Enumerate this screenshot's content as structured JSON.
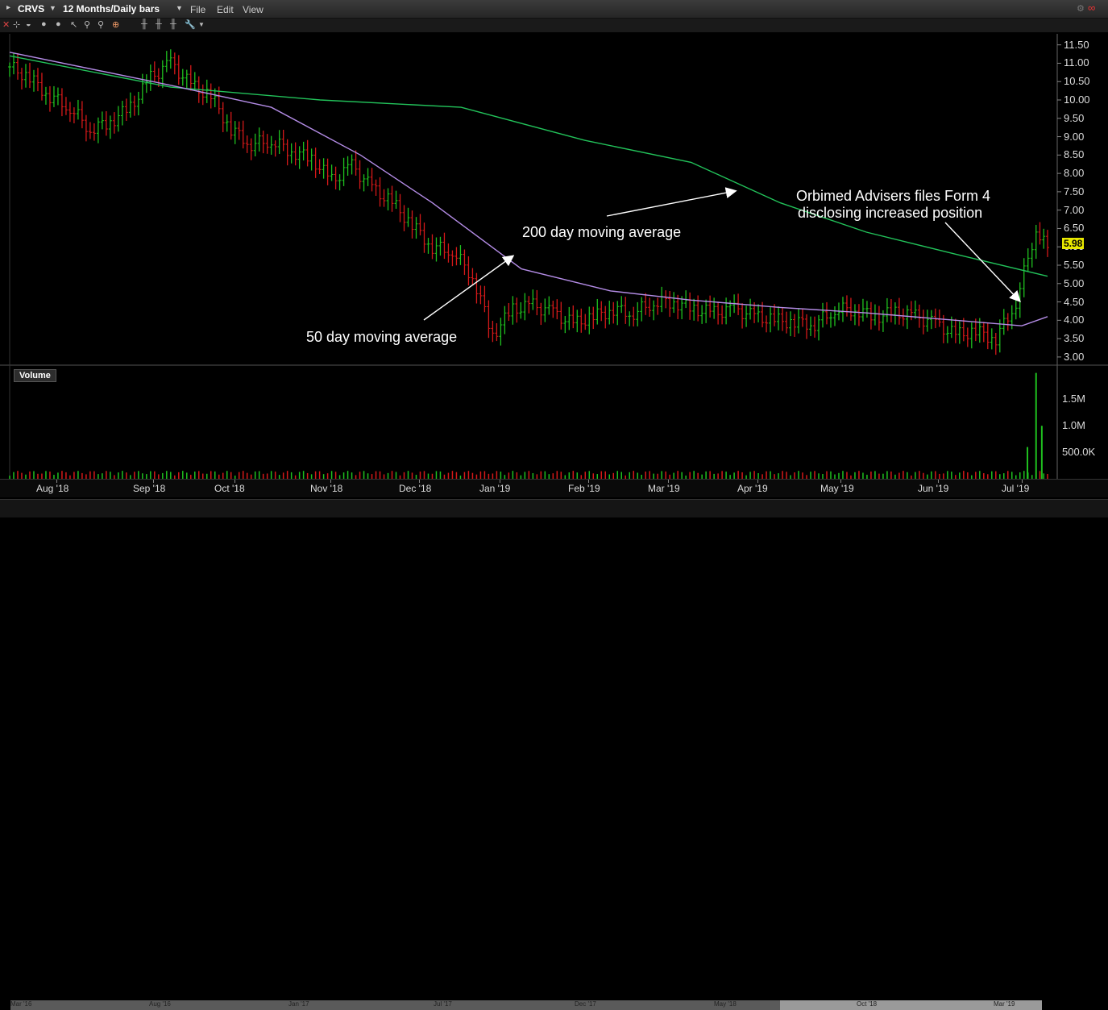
{
  "window": {
    "symbol": "CRVS",
    "period": "12 Months/Daily bars",
    "menu": [
      "File",
      "Edit",
      "View"
    ]
  },
  "toolbar": {
    "icons": [
      "close-icon",
      "crosshair-icon",
      "circle-icon",
      "circle-icon",
      "pointer-icon",
      "zoom-in-icon",
      "zoom-out-icon",
      "target-icon",
      "bar-style-icon",
      "bar-style-icon",
      "bar-style-icon",
      "wrench-icon",
      "dropdown-icon"
    ]
  },
  "price_axis_labels": [
    "11.50",
    "11.00",
    "10.50",
    "10.00",
    "9.50",
    "9.00",
    "8.50",
    "8.00",
    "7.50",
    "7.00",
    "6.50",
    "6.00",
    "5.50",
    "5.00",
    "4.50",
    "4.00",
    "3.50",
    "3.00"
  ],
  "last_price": "5.98",
  "volume_title": "Volume",
  "volume_axis_labels": [
    "1.5M",
    "1.0M",
    "500.0K"
  ],
  "annotations": {
    "ma200": "200 day moving average",
    "ma50": "50 day moving average",
    "orbimed_line1": "Orbimed Advisers files Form 4",
    "orbimed_line2": "disclosing increased position"
  },
  "date_labels": [
    "Aug '18",
    "Sep '18",
    "Oct '18",
    "Nov '18",
    "Dec '18",
    "Jan '19",
    "Feb '19",
    "Mar '19",
    "Apr '19",
    "May '19",
    "Jun '19",
    "Jul '19"
  ],
  "nav_labels": [
    "Mar '16",
    "Aug '16",
    "Jan '17",
    "Jul '17",
    "Dec '17",
    "May '18",
    "Oct '18",
    "Mar '19"
  ],
  "colors": {
    "up": "#1fc01f",
    "down": "#d41919",
    "ma50": "#b48ce6",
    "ma200": "#22c25a",
    "grid": "#333333"
  },
  "chart_data": {
    "type": "ohlc",
    "title": "CRVS",
    "ylim": [
      2.8,
      11.8
    ],
    "x_start": "2018-07-16",
    "x_end": "2019-07-12",
    "close_series": [
      [
        "2018-07-16",
        10.9
      ],
      [
        "2018-07-23",
        10.6
      ],
      [
        "2018-07-30",
        10.1
      ],
      [
        "2018-08-06",
        9.8
      ],
      [
        "2018-08-13",
        9.2
      ],
      [
        "2018-08-20",
        9.4
      ],
      [
        "2018-08-27",
        9.8
      ],
      [
        "2018-09-03",
        10.6
      ],
      [
        "2018-09-10",
        11.0
      ],
      [
        "2018-09-17",
        10.4
      ],
      [
        "2018-09-24",
        10.1
      ],
      [
        "2018-10-01",
        9.2
      ],
      [
        "2018-10-08",
        8.8
      ],
      [
        "2018-10-15",
        8.9
      ],
      [
        "2018-10-22",
        8.6
      ],
      [
        "2018-10-29",
        8.4
      ],
      [
        "2018-11-05",
        7.8
      ],
      [
        "2018-11-12",
        8.2
      ],
      [
        "2018-11-19",
        7.6
      ],
      [
        "2018-11-26",
        7.2
      ],
      [
        "2018-12-03",
        6.6
      ],
      [
        "2018-12-10",
        6.0
      ],
      [
        "2018-12-17",
        5.9
      ],
      [
        "2018-12-24",
        5.2
      ],
      [
        "2018-12-31",
        3.6
      ],
      [
        "2019-01-07",
        4.3
      ],
      [
        "2019-01-14",
        4.4
      ],
      [
        "2019-01-21",
        4.2
      ],
      [
        "2019-01-28",
        3.9
      ],
      [
        "2019-02-04",
        4.1
      ],
      [
        "2019-02-11",
        4.3
      ],
      [
        "2019-02-18",
        4.2
      ],
      [
        "2019-02-25",
        4.5
      ],
      [
        "2019-03-04",
        4.5
      ],
      [
        "2019-03-11",
        4.3
      ],
      [
        "2019-03-18",
        4.2
      ],
      [
        "2019-03-25",
        4.3
      ],
      [
        "2019-04-01",
        4.1
      ],
      [
        "2019-04-08",
        4.0
      ],
      [
        "2019-04-15",
        3.95
      ],
      [
        "2019-04-22",
        3.9
      ],
      [
        "2019-04-29",
        4.3
      ],
      [
        "2019-05-06",
        4.3
      ],
      [
        "2019-05-13",
        4.1
      ],
      [
        "2019-05-20",
        4.2
      ],
      [
        "2019-05-27",
        4.1
      ],
      [
        "2019-06-03",
        3.9
      ],
      [
        "2019-06-10",
        3.6
      ],
      [
        "2019-06-17",
        3.7
      ],
      [
        "2019-06-24",
        3.5
      ],
      [
        "2019-07-01",
        4.5
      ],
      [
        "2019-07-08",
        6.5
      ],
      [
        "2019-07-12",
        5.98
      ]
    ],
    "ma50": [
      [
        "2018-07-16",
        11.3
      ],
      [
        "2018-09-10",
        10.4
      ],
      [
        "2018-10-15",
        9.8
      ],
      [
        "2018-11-15",
        8.5
      ],
      [
        "2018-12-10",
        7.2
      ],
      [
        "2019-01-10",
        5.4
      ],
      [
        "2019-02-10",
        4.8
      ],
      [
        "2019-03-10",
        4.55
      ],
      [
        "2019-04-10",
        4.35
      ],
      [
        "2019-05-10",
        4.2
      ],
      [
        "2019-06-10",
        4.0
      ],
      [
        "2019-07-03",
        3.85
      ],
      [
        "2019-07-12",
        4.1
      ]
    ],
    "ma200": [
      [
        "2018-07-16",
        11.2
      ],
      [
        "2018-09-10",
        10.35
      ],
      [
        "2018-11-01",
        10.0
      ],
      [
        "2018-12-20",
        9.8
      ],
      [
        "2019-02-01",
        8.9
      ],
      [
        "2019-03-10",
        8.3
      ],
      [
        "2019-04-10",
        7.2
      ],
      [
        "2019-05-10",
        6.4
      ],
      [
        "2019-06-10",
        5.8
      ],
      [
        "2019-07-12",
        5.2
      ]
    ],
    "volume": [
      [
        "2019-07-05",
        600000
      ],
      [
        "2019-07-08",
        2000000
      ],
      [
        "2019-07-10",
        1000000
      ]
    ],
    "volume_ylim": [
      0,
      2100000
    ]
  }
}
